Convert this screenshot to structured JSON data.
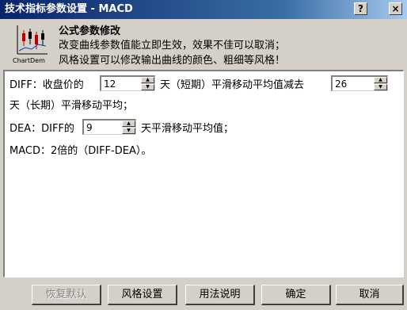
{
  "window": {
    "title": "技术指标参数设置 - MACD",
    "help_label": "?",
    "close_label": "×"
  },
  "header": {
    "logo_text": "ChartDem",
    "title": "公式参数修改",
    "line1": "改变曲线参数值能立即生效，效果不佳可以取消；",
    "line2": "风格设置可以修改输出曲线的颜色、粗细等风格！"
  },
  "params": {
    "row1_prefix": "DIFF：收盘价的",
    "short_value": "12",
    "row1_middle": "天（短期）平滑移动平均值减去",
    "long_value": "26",
    "row2_text": "天（长期）平滑移动平均；",
    "row3_prefix": "DEA：DIFF的",
    "dea_value": "9",
    "row3_suffix": "天平滑移动平均值；",
    "row4_text": "MACD：2倍的（DIFF-DEA）。"
  },
  "footer": {
    "restore_label": "恢复默认",
    "style_label": "风格设置",
    "usage_label": "用法说明",
    "ok_label": "确定",
    "cancel_label": "取消"
  },
  "colors": {
    "titlebar_start": "#0a246a",
    "titlebar_end": "#a6caf0",
    "dialog_bg": "#d4d0c8"
  }
}
